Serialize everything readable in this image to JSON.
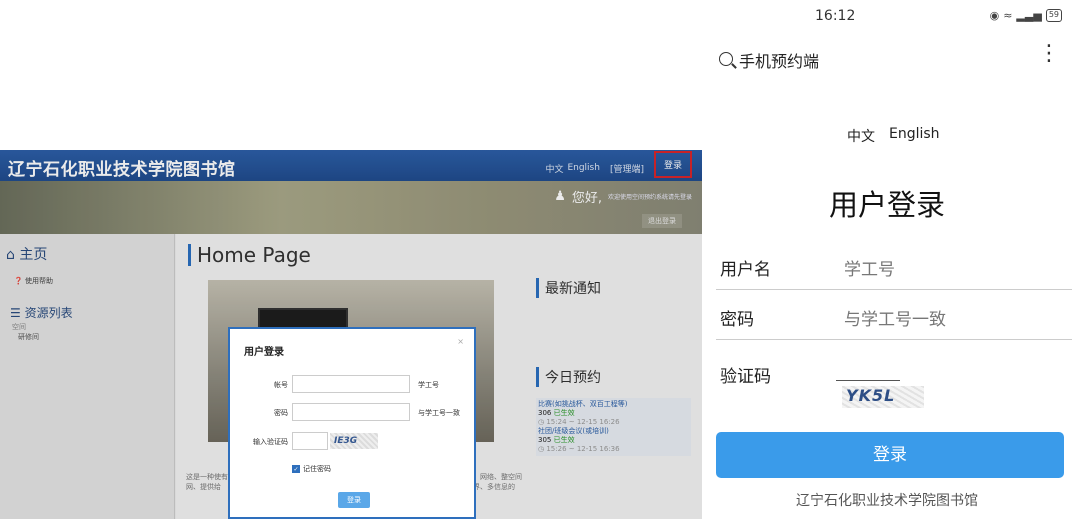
{
  "desktop": {
    "site_title": "辽宁石化职业技术学院图书馆",
    "nav": {
      "lang_zh": "中文",
      "lang_en": "English",
      "admin": "[管理端]",
      "login": "登录"
    },
    "banner": {
      "hello": "您好,",
      "welcome": "欢迎使用空间预约系统请先登录",
      "logout": "退出登录"
    },
    "sidebar": {
      "home": "主页",
      "help": "使用帮助",
      "resource_list": "资源列表",
      "space": "空间",
      "study_room": "研修间"
    },
    "main": {
      "page_title": "Home Page",
      "notice_title": "最新通知",
      "today_title": "今日预约",
      "bookings": [
        {
          "title": "比赛(如挑战杯、双百工程等)",
          "room": "306",
          "status": "已生效",
          "time": "15:24 ~ 12-15 16:26"
        },
        {
          "title": "社团/班级会议(或培训)",
          "room": "305",
          "status": "已生效",
          "time": "15:26 ~ 12-15 16:36"
        }
      ],
      "intro_left": "这是一种使有线电视、网、提供给",
      "intro_right": "机、网络、整空间的界、多信息的"
    },
    "modal": {
      "title": "用户登录",
      "close": "×",
      "account_label": "帐号",
      "account_hint": "学工号",
      "password_label": "密码",
      "password_hint": "与学工号一致",
      "captcha_label": "输入验证码",
      "captcha_text": "IE3G",
      "remember": "记住密码",
      "submit": "登录"
    }
  },
  "phone": {
    "status": {
      "time": "16:12",
      "battery": "59"
    },
    "app_title": "手机预约端",
    "more": "⋮",
    "lang_zh": "中文",
    "lang_en": "English",
    "heading": "用户登录",
    "username_label": "用户名",
    "username_placeholder": "学工号",
    "password_label": "密码",
    "password_placeholder": "与学工号一致",
    "captcha_label": "验证码",
    "captcha_text": "YK5L",
    "login_button": "登录",
    "footer": "辽宁石化职业技术学院图书馆"
  },
  "colors": {
    "accent": "#3a9bea",
    "desktop_header": "#2d5fa8",
    "highlight": "#d9252b"
  }
}
